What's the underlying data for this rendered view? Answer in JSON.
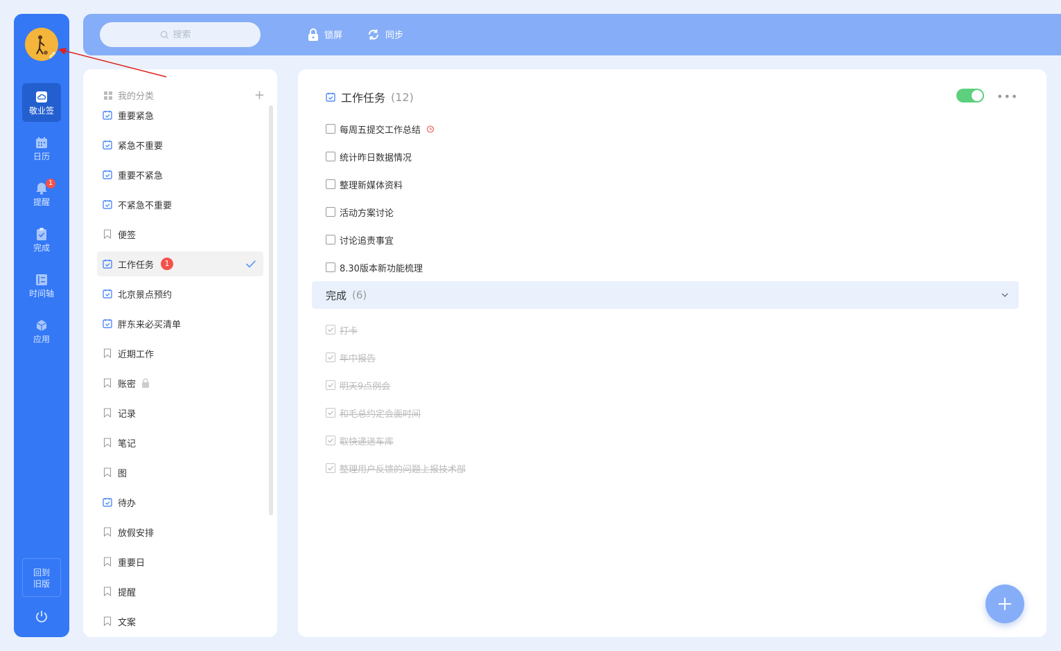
{
  "search": {
    "placeholder": "搜索"
  },
  "topbar": {
    "lock_label": "锁屏",
    "sync_label": "同步"
  },
  "rail": {
    "items": [
      {
        "label": "敬业签",
        "icon": "note-cloud-icon",
        "active": true
      },
      {
        "label": "日历",
        "icon": "calendar-icon"
      },
      {
        "label": "提醒",
        "icon": "bell-icon",
        "badge": "1"
      },
      {
        "label": "完成",
        "icon": "clipboard-check-icon"
      },
      {
        "label": "时间轴",
        "icon": "timeline-icon"
      },
      {
        "label": "应用",
        "icon": "cube-icon"
      }
    ],
    "old_version_label_1": "回到",
    "old_version_label_2": "旧版"
  },
  "categories": {
    "title": "我的分类",
    "items": [
      {
        "label": "重要紧急",
        "icon": "task-icon"
      },
      {
        "label": "紧急不重要",
        "icon": "task-icon"
      },
      {
        "label": "重要不紧急",
        "icon": "task-icon"
      },
      {
        "label": "不紧急不重要",
        "icon": "task-icon"
      },
      {
        "label": "便签",
        "icon": "bookmark-icon"
      },
      {
        "label": "工作任务",
        "icon": "task-icon",
        "badge": "1",
        "active": true
      },
      {
        "label": "北京景点预约",
        "icon": "task-icon"
      },
      {
        "label": "胖东来必买清单",
        "icon": "task-icon"
      },
      {
        "label": "近期工作",
        "icon": "bookmark-icon"
      },
      {
        "label": "账密",
        "icon": "bookmark-icon",
        "locked": true
      },
      {
        "label": "记录",
        "icon": "bookmark-icon"
      },
      {
        "label": "笔记",
        "icon": "bookmark-icon"
      },
      {
        "label": "图",
        "icon": "bookmark-icon"
      },
      {
        "label": "待办",
        "icon": "task-icon"
      },
      {
        "label": "放假安排",
        "icon": "bookmark-icon"
      },
      {
        "label": "重要日",
        "icon": "bookmark-icon"
      },
      {
        "label": "提醒",
        "icon": "bookmark-icon"
      },
      {
        "label": "文案",
        "icon": "bookmark-icon"
      }
    ]
  },
  "main": {
    "title": "工作任务",
    "count": "(12)",
    "toggle_on": true,
    "todos": [
      {
        "text": "每周五提交工作总结",
        "alarm": true
      },
      {
        "text": "统计昨日数据情况"
      },
      {
        "text": "整理新媒体资料"
      },
      {
        "text": "活动方案讨论"
      },
      {
        "text": "讨论追责事宜"
      },
      {
        "text": "8.30版本新功能梳理"
      }
    ],
    "done_label": "完成",
    "done_count": "(6)",
    "done_items": [
      "打卡",
      "年中报告",
      "明天9点例会",
      "和毛总约定会面时间",
      "取快递送车库",
      "整理用户反馈的问题上报技术部"
    ]
  },
  "colors": {
    "rail": "#3478f6",
    "topbar": "#86adf7",
    "background": "#eaf1fd",
    "badge": "#f5514b",
    "toggle": "#5cd07c",
    "accent": "#3478f6"
  }
}
